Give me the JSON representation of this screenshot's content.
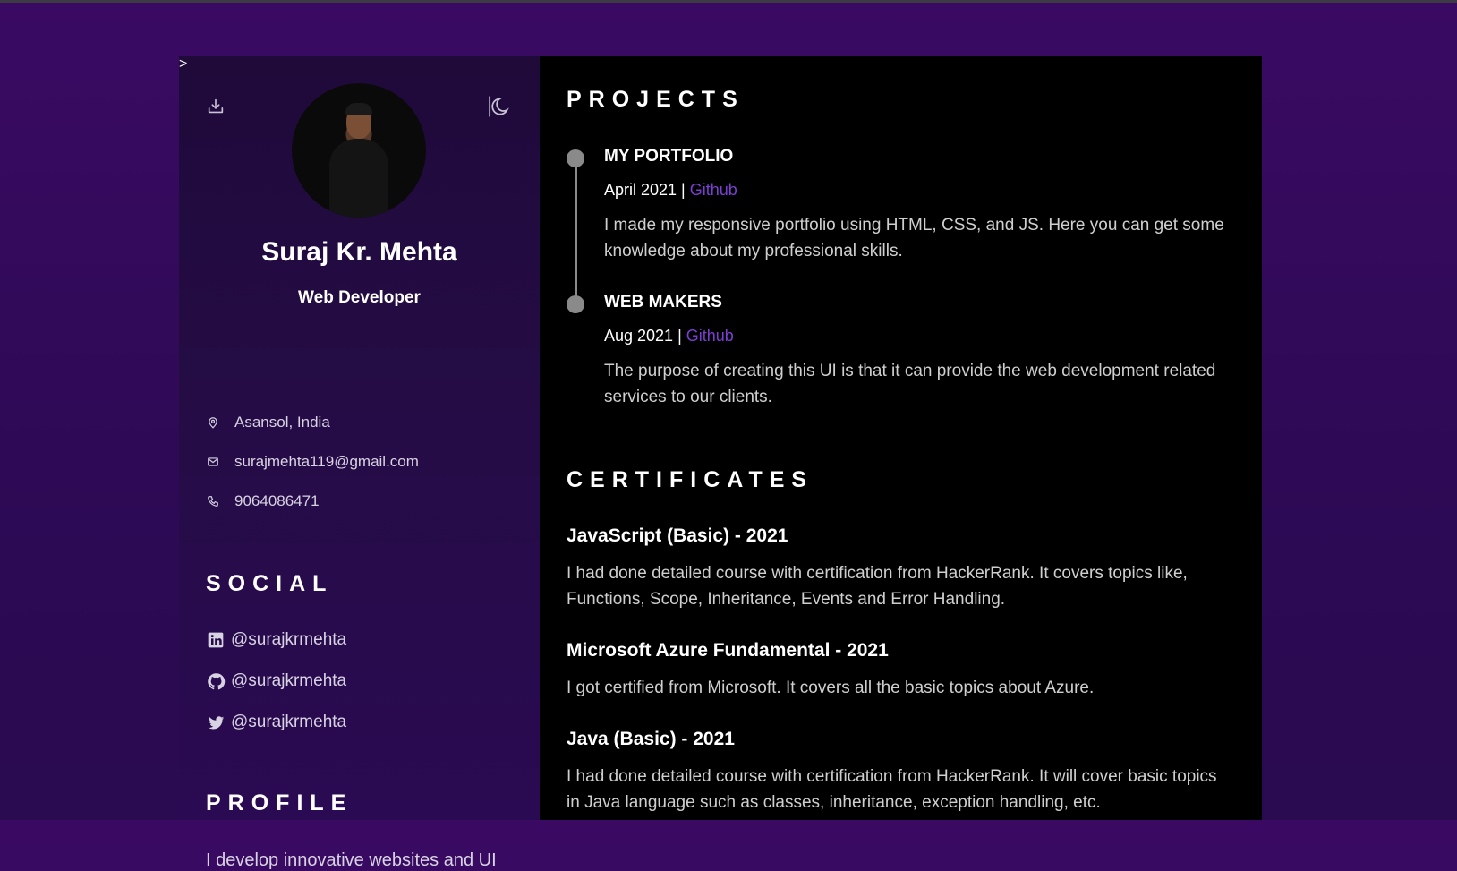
{
  "colors": {
    "accent": "#7a3fd0",
    "background": "#3a0a63",
    "panel_right": "#000000"
  },
  "profile": {
    "name": "Suraj Kr. Mehta",
    "role": "Web Developer",
    "avatar_icon": "profile-photo"
  },
  "contacts": [
    {
      "icon": "location-pin-icon",
      "text": "Asansol, India"
    },
    {
      "icon": "mail-icon",
      "text": "surajmehta119@gmail.com"
    },
    {
      "icon": "phone-icon",
      "text": "9064086471"
    }
  ],
  "social": {
    "title": "SOCIAL",
    "items": [
      {
        "icon": "linkedin-icon",
        "text": "@surajkrmehta"
      },
      {
        "icon": "github-icon",
        "text": "@surajkrmehta"
      },
      {
        "icon": "twitter-icon",
        "text": "@surajkrmehta"
      }
    ]
  },
  "profile_section": {
    "title": "PROFILE",
    "text": "I develop innovative websites and UI"
  },
  "projects": {
    "title": "PROJECTS",
    "items": [
      {
        "title": "MY PORTFOLIO",
        "date": "April 2021 |",
        "link": "Github",
        "desc": "I made my responsive portfolio using HTML, CSS, and JS. Here you can get some knowledge about my professional skills."
      },
      {
        "title": "WEB MAKERS",
        "date": "Aug 2021 |",
        "link": "Github",
        "desc": "The purpose of creating this UI is that it can provide the web development related services to our clients."
      }
    ]
  },
  "certificates": {
    "title": "CERTIFICATES",
    "items": [
      {
        "title": "JavaScript (Basic) - 2021",
        "desc": "I had done detailed course with certification from HackerRank. It covers topics like, Functions, Scope, Inheritance, Events and Error Handling."
      },
      {
        "title": "Microsoft Azure Fundamental - 2021",
        "desc": "I got certified from Microsoft. It covers all the basic topics about Azure."
      },
      {
        "title": "Java (Basic) - 2021",
        "desc": "I had done detailed course with certification from HackerRank. It will cover basic topics in Java language such as classes, inheritance, exception handling, etc."
      }
    ]
  }
}
